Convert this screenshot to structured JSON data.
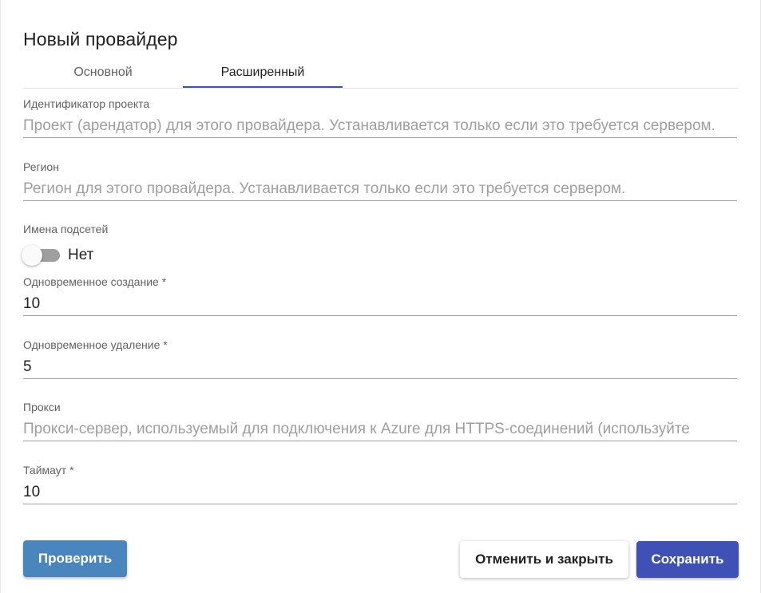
{
  "dialog": {
    "title": "Новый провайдер"
  },
  "tabs": [
    {
      "label": "Основной",
      "active": false
    },
    {
      "label": "Расширенный",
      "active": true
    }
  ],
  "colors": {
    "accent": "#3f51b5",
    "test_button": "#4a86be",
    "label": "#616161",
    "placeholder": "#9e9e9e"
  },
  "fields": {
    "project_id": {
      "label": "Идентификатор проекта",
      "value": "",
      "placeholder": "Проект (арендатор) для этого провайдера. Устанавливается только если это требуется сервером."
    },
    "region": {
      "label": "Регион",
      "value": "",
      "placeholder": "Регион для этого провайдера. Устанавливается только если это требуется сервером."
    },
    "subnets": {
      "label": "Имена подсетей",
      "state_text": "Нет",
      "checked": false
    },
    "concurrent_create": {
      "label": "Одновременное создание *",
      "value": "10",
      "placeholder": ""
    },
    "concurrent_delete": {
      "label": "Одновременное удаление *",
      "value": "5",
      "placeholder": ""
    },
    "proxy": {
      "label": "Прокси",
      "value": "",
      "placeholder": "Прокси-сервер, используемый для подключения к Azure для HTTPS-соединений (используйте"
    },
    "timeout": {
      "label": "Таймаут *",
      "value": "10",
      "placeholder": ""
    }
  },
  "buttons": {
    "test": "Проверить",
    "cancel": "Отменить и закрыть",
    "save": "Сохранить"
  }
}
